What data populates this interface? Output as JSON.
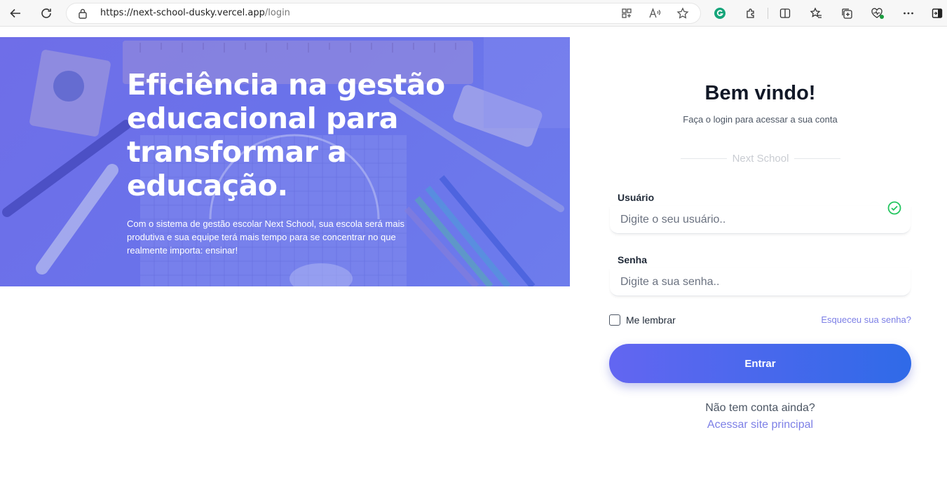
{
  "browser": {
    "url_host": "https://next-school-dusky.vercel.app",
    "url_path": "/login"
  },
  "hero": {
    "title": "Eficiência na gestão educacional para transformar a educação.",
    "description": "Com o sistema de gestão escolar Next School, sua escola será mais produtiva e sua equipe terá mais tempo para se concentrar no que realmente importa: ensinar!"
  },
  "login": {
    "title": "Bem vindo!",
    "subtitle": "Faça o login para acessar a sua conta",
    "brand": "Next School",
    "username_label": "Usuário",
    "username_placeholder": "Digite o seu usuário..",
    "password_label": "Senha",
    "password_placeholder": "Digite a sua senha..",
    "remember_label": "Me lembrar",
    "forgot_link": "Esqueceu sua senha?",
    "submit_label": "Entrar",
    "no_account_text": "Não tem conta ainda?",
    "main_site_link": "Acessar site principal"
  },
  "colors": {
    "accent": "#6366f1",
    "button_end": "#2f6ae8",
    "link": "#7c7fe6",
    "success": "#22c55e",
    "hero_overlay": "#6d70ea"
  },
  "icons": [
    "back-arrow-icon",
    "refresh-icon",
    "lock-icon",
    "grid-icon",
    "read-aloud-icon",
    "star-icon",
    "grammarly-icon",
    "extensions-icon",
    "split-screen-icon",
    "favorites-icon",
    "collections-icon",
    "heart-pulse-icon",
    "more-icon",
    "sidebar-icon",
    "check-circle-icon"
  ]
}
